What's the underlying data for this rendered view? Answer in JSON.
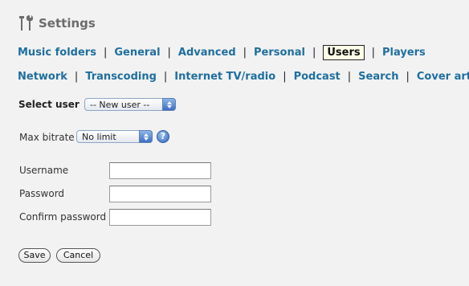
{
  "header": {
    "title": "Settings",
    "icon": "tools-icon"
  },
  "nav": {
    "row1": [
      "Music folders",
      "General",
      "Advanced",
      "Personal",
      "Users",
      "Players"
    ],
    "row2": [
      "Network",
      "Transcoding",
      "Internet TV/radio",
      "Podcast",
      "Search",
      "Cover art"
    ],
    "active": "Users",
    "separator": "|",
    "link_color": "#1f6f9e"
  },
  "form": {
    "select_user_label": "Select user",
    "select_user_value": "-- New user --",
    "max_bitrate_label": "Max bitrate",
    "max_bitrate_value": "No limit",
    "help_glyph": "?",
    "username_label": "Username",
    "password_label": "Password",
    "confirm_password_label": "Confirm password",
    "username_value": "",
    "password_value": "",
    "confirm_password_value": ""
  },
  "buttons": {
    "save": "Save",
    "cancel": "Cancel"
  }
}
